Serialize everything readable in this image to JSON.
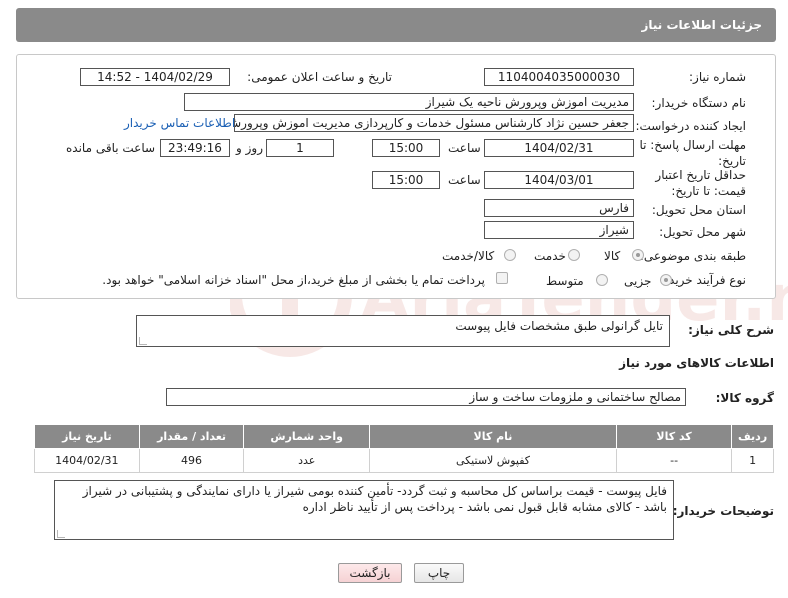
{
  "header": {
    "title": "جزئیات اطلاعات نیاز"
  },
  "need_number": {
    "label": "شماره نیاز:",
    "value": "1104004035000030"
  },
  "announce": {
    "label": "تاریخ و ساعت اعلان عمومی:",
    "value": "1404/02/29 - 14:52"
  },
  "buyer_org": {
    "label": "نام دستگاه خریدار:",
    "value": "مدیریت اموزش وپرورش ناحیه یک شیراز"
  },
  "requester": {
    "label": "ایجاد کننده درخواست:",
    "value": "جعفر حسین نژاد کارشناس مسئول خدمات و کارپردازی مدیریت اموزش وپرورش ن",
    "contact_link": "اطلاعات تماس خریدار"
  },
  "deadline": {
    "label": "مهلت ارسال پاسخ: تا تاریخ:",
    "date": "1404/02/31",
    "time_label": "ساعت",
    "time": "15:00",
    "days": "1",
    "days_label": "روز و",
    "remaining": "23:49:16",
    "remaining_label": "ساعت باقی مانده"
  },
  "price_validity": {
    "label": "حداقل تاریخ اعتبار قیمت: تا تاریخ:",
    "date": "1404/03/01",
    "time_label": "ساعت",
    "time": "15:00"
  },
  "province": {
    "label": "استان محل تحویل:",
    "value": "فارس"
  },
  "city": {
    "label": "شهر محل تحویل:",
    "value": "شیراز"
  },
  "category": {
    "label": "طبقه بندی موضوعی:",
    "options": [
      "کالا",
      "خدمت",
      "کالا/خدمت"
    ]
  },
  "purchase_process": {
    "label": "نوع فرآیند خرید :",
    "options": [
      "جزیی",
      "متوسط"
    ],
    "payment_note": "پرداخت تمام یا بخشی از مبلغ خرید،از محل \"اسناد خزانه اسلامی\" خواهد بود."
  },
  "description": {
    "label": "شرح کلی نیاز:",
    "value": "تایل گرانولی طبق مشخصات فایل پیوست"
  },
  "goods_info": {
    "title": "اطلاعات کالاهای مورد نیاز"
  },
  "goods_group": {
    "label": "گروه کالا:",
    "value": "مصالح ساختمانی و ملزومات ساخت و ساز"
  },
  "table": {
    "headers": [
      "ردیف",
      "کد کالا",
      "نام کالا",
      "واحد شمارش",
      "تعداد / مقدار",
      "تاریخ نیاز"
    ],
    "rows": [
      [
        "1",
        "--",
        "کفپوش لاستیکی",
        "عدد",
        "496",
        "1404/02/31"
      ]
    ]
  },
  "buyer_notes": {
    "label": "توضیحات خریدار:",
    "value": "فایل پیوست - قیمت براساس کل محاسبه و ثبت گردد- تأمین کننده بومی شیراز یا دارای نمایندگی و پشتیبانی در شیراز باشد - کالای مشابه قابل قبول نمی باشد - پرداخت پس از تأیید ناظر اداره"
  },
  "buttons": {
    "print": "چاپ",
    "back": "بازگشت"
  },
  "watermark": {
    "text": "AriaTender.net"
  }
}
